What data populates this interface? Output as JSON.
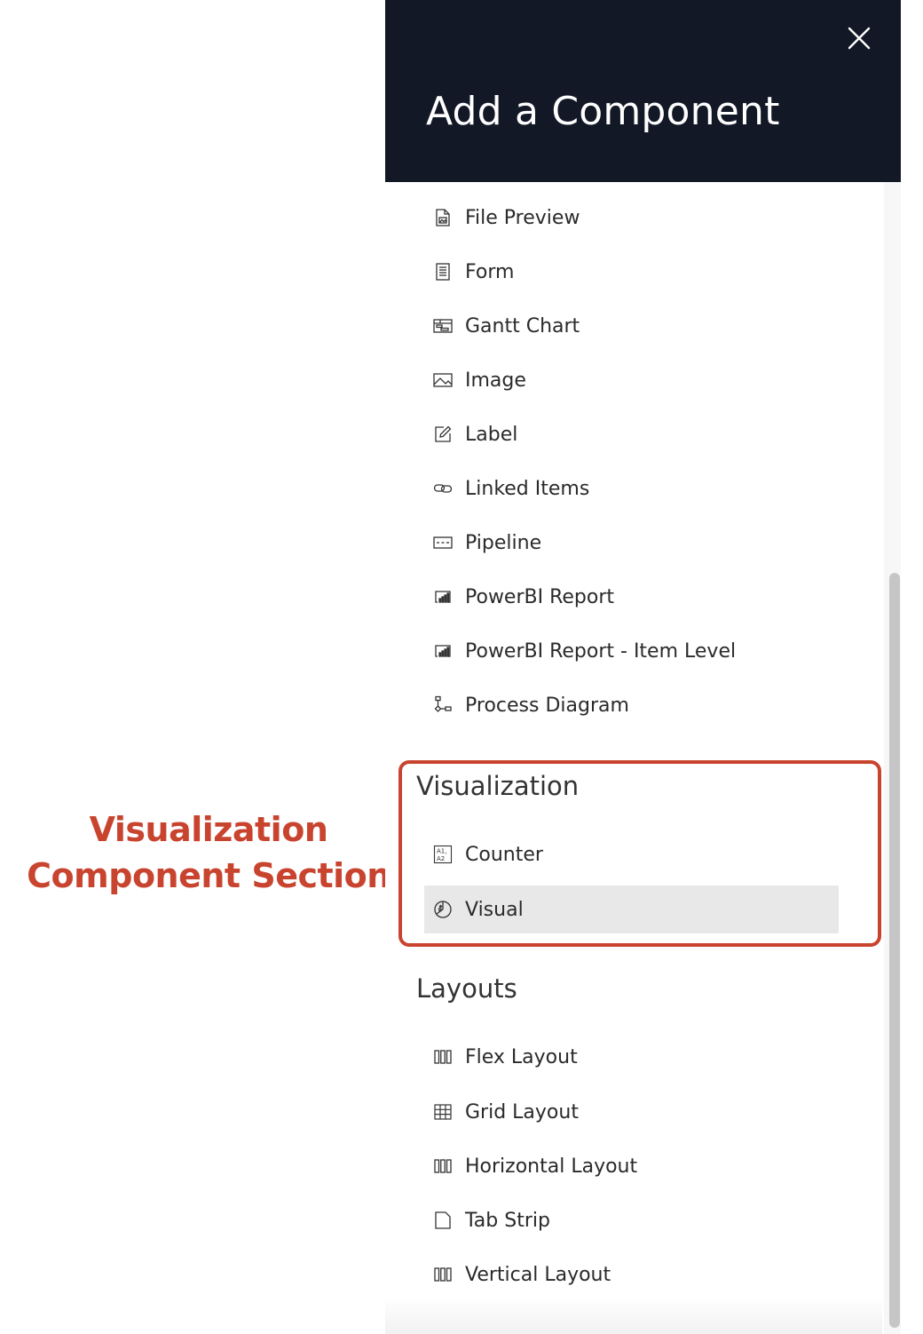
{
  "annotation": {
    "line1": "Visualization",
    "line2": "Component Section"
  },
  "panel": {
    "title": "Add a Component",
    "close_icon": "close-icon"
  },
  "components": [
    {
      "label": "File Preview",
      "icon": "file-preview-icon"
    },
    {
      "label": "Form",
      "icon": "form-icon"
    },
    {
      "label": "Gantt Chart",
      "icon": "gantt-chart-icon"
    },
    {
      "label": "Image",
      "icon": "image-icon"
    },
    {
      "label": "Label",
      "icon": "label-icon"
    },
    {
      "label": "Linked Items",
      "icon": "link-icon"
    },
    {
      "label": "Pipeline",
      "icon": "pipeline-icon"
    },
    {
      "label": "PowerBI Report",
      "icon": "powerbi-report-icon"
    },
    {
      "label": "PowerBI Report - Item Level",
      "icon": "powerbi-report-icon"
    },
    {
      "label": "Process Diagram",
      "icon": "process-diagram-icon"
    }
  ],
  "visualization": {
    "title": "Visualization",
    "items": [
      {
        "label": "Counter",
        "icon": "counter-icon"
      },
      {
        "label": "Visual",
        "icon": "visual-icon",
        "selected": true
      }
    ]
  },
  "layouts": {
    "title": "Layouts",
    "items": [
      {
        "label": "Flex Layout",
        "icon": "flex-layout-icon"
      },
      {
        "label": "Grid Layout",
        "icon": "grid-layout-icon"
      },
      {
        "label": "Horizontal Layout",
        "icon": "horizontal-layout-icon"
      },
      {
        "label": "Tab Strip",
        "icon": "tab-strip-icon"
      },
      {
        "label": "Vertical Layout",
        "icon": "vertical-layout-icon"
      }
    ]
  },
  "colors": {
    "header_bg": "#121826",
    "annotation": "#c9442f",
    "selected_bg": "#e8e8e8"
  }
}
